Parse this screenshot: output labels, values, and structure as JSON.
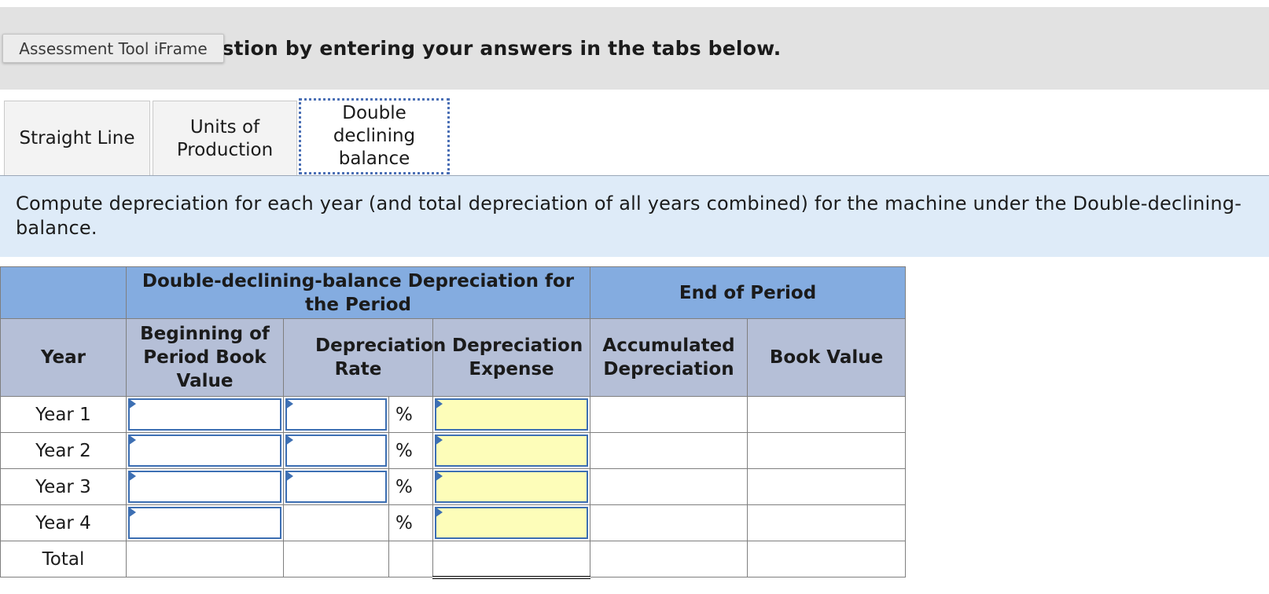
{
  "header": {
    "instruction_text": "Complete this question by entering your answers in the tabs below.",
    "visible_text": "estion by entering your answers in the tabs below.",
    "tooltip": "Assessment Tool iFrame"
  },
  "tabs": [
    {
      "label": "Straight Line",
      "active": false
    },
    {
      "label": "Units of Production",
      "active": false
    },
    {
      "label": "Double declining balance",
      "active": true
    }
  ],
  "instruction": "Compute depreciation for each year (and total depreciation of all years combined) for the machine under the Double-declining-balance.",
  "table": {
    "group_header_left": "Double-declining-balance Depreciation for the Period",
    "group_header_right": "End of Period",
    "columns": [
      "Year",
      "Beginning of Period Book Value",
      "Depreciation Rate",
      "Depreciation Expense",
      "Accumulated Depreciation",
      "Book Value"
    ],
    "percent_symbol": "%",
    "rows": [
      {
        "year": "Year 1"
      },
      {
        "year": "Year 2"
      },
      {
        "year": "Year 3"
      },
      {
        "year": "Year 4"
      },
      {
        "year": "Total"
      }
    ]
  },
  "colors": {
    "header_blue": "#84ace0",
    "subheader_gray_blue": "#b5bfd7",
    "input_border": "#3d6fb3",
    "expense_yellow": "#fdfdb9",
    "instruction_bg": "#deebf8"
  }
}
